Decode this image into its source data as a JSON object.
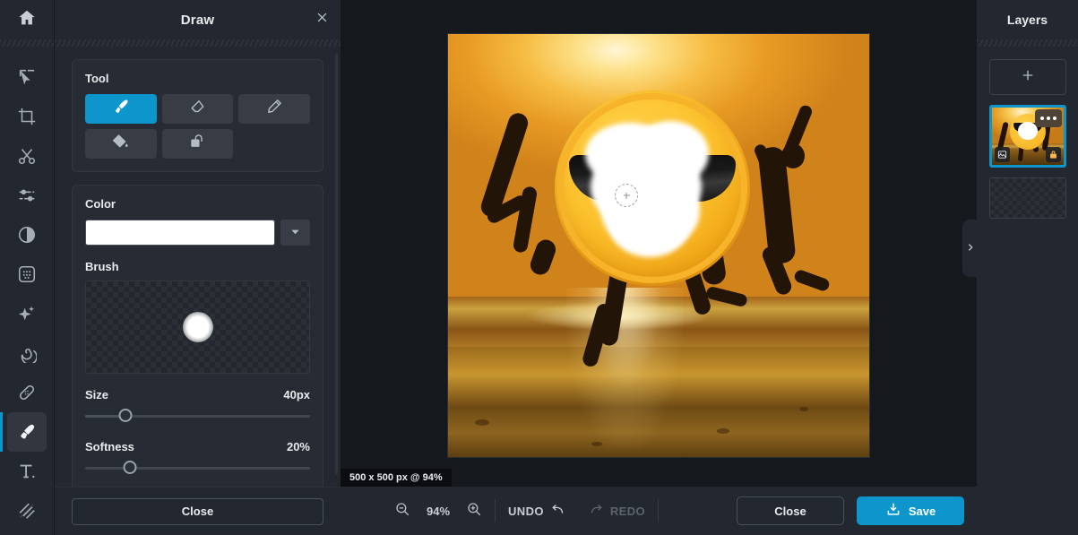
{
  "rail": {
    "home_icon": "home-icon",
    "items": [
      {
        "name": "select",
        "icon": "cursor-select-icon",
        "active": false
      },
      {
        "name": "crop",
        "icon": "crop-icon",
        "active": false
      },
      {
        "name": "cut",
        "icon": "scissors-icon",
        "active": false
      },
      {
        "name": "adjust",
        "icon": "sliders-icon",
        "active": false
      },
      {
        "name": "contrast",
        "icon": "contrast-icon",
        "active": false
      },
      {
        "name": "pixelate",
        "icon": "pixelate-icon",
        "active": false
      },
      {
        "name": "effects",
        "icon": "sparkle-icon",
        "active": false
      },
      {
        "name": "swirl",
        "icon": "spiral-icon",
        "active": false
      },
      {
        "name": "heal",
        "icon": "bandage-icon",
        "active": false
      },
      {
        "name": "draw",
        "icon": "brush-icon",
        "active": true
      },
      {
        "name": "text",
        "icon": "text-icon",
        "active": false
      },
      {
        "name": "texture",
        "icon": "stripes-icon",
        "active": false
      }
    ]
  },
  "panel": {
    "title": "Draw",
    "close_icon": "close-icon",
    "tool_section_label": "Tool",
    "tools": [
      {
        "name": "brush",
        "icon": "brush-icon",
        "selected": true
      },
      {
        "name": "eraser",
        "icon": "eraser-icon",
        "selected": false
      },
      {
        "name": "pencil",
        "icon": "pencil-icon",
        "selected": false
      },
      {
        "name": "fill",
        "icon": "paint-bucket-icon",
        "selected": false
      },
      {
        "name": "shape",
        "icon": "lasso-shape-icon",
        "selected": false
      }
    ],
    "color_label": "Color",
    "color_value": "#FFFFFF",
    "color_dropdown_icon": "chevron-down-icon",
    "brush_label": "Brush",
    "size_label": "Size",
    "size_value": "40px",
    "size_percent": 18,
    "softness_label": "Softness",
    "softness_value": "20%",
    "softness_percent": 20,
    "close_label": "Close"
  },
  "canvas": {
    "status": "500 x 500 px @ 94%",
    "brush_cursor_icon": "brush-cursor-icon"
  },
  "bottombar": {
    "zoom_out_icon": "zoom-out-icon",
    "zoom_level": "94%",
    "zoom_in_icon": "zoom-in-icon",
    "undo_label": "UNDO",
    "undo_icon": "undo-arrow-icon",
    "redo_label": "REDO",
    "redo_icon": "redo-arrow-icon",
    "close_label": "Close",
    "save_label": "Save",
    "save_icon": "save-download-icon",
    "accent_color": "#0C96CC"
  },
  "layers": {
    "title": "Layers",
    "add_icon": "plus-icon",
    "items": [
      {
        "name": "image-layer",
        "selected": true,
        "menu_icon": "more-dots-icon",
        "type_icon": "image-icon",
        "lock_icon": "lock-icon"
      },
      {
        "name": "empty-layer",
        "selected": false
      }
    ],
    "collapse_icon": "chevron-right-icon"
  }
}
